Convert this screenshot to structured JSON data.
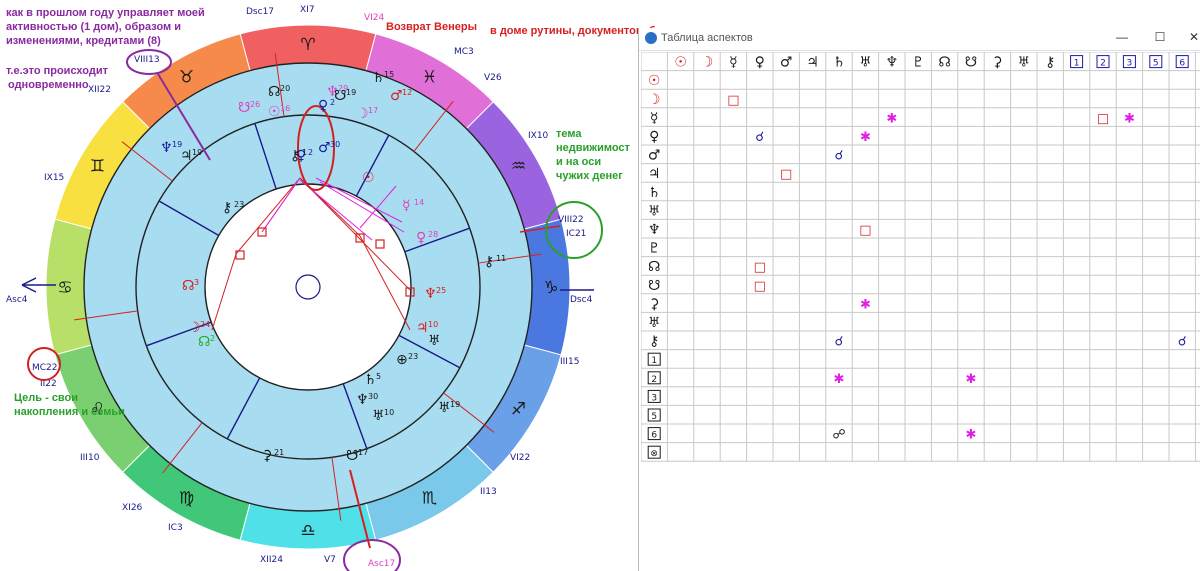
{
  "notes": {
    "top_left": [
      "как в прошлом году управляет моей",
      "активностью (1 дом), образом и",
      "изменениями, кредитами (8)"
    ],
    "happening": [
      "т.е.это происходит",
      "одновременно"
    ],
    "venus_return": "Возврат Венеры",
    "routine_house": "в доме рутины, документов, быта",
    "estate_theme": [
      "тема",
      "недвижимост",
      "и на оси",
      "чужих денег"
    ],
    "goal": [
      "Цель - свои",
      "накопления и семьи"
    ]
  },
  "colors": {
    "note_purple": "#8a2aa0",
    "note_red": "#d62020",
    "note_green": "#2aa02a",
    "wheel_inner": "#a8dcf0",
    "square": "#d62020",
    "sextile": "#e020e0",
    "trine": "#20b020",
    "conjunction": "#1a1aa0"
  },
  "zodiac_ring": [
    {
      "sign": "aries",
      "glyph": "♈",
      "color": "#f06060"
    },
    {
      "sign": "taurus",
      "glyph": "♉",
      "color": "#f58a4a"
    },
    {
      "sign": "gemini",
      "glyph": "♊",
      "color": "#f8e040"
    },
    {
      "sign": "cancer",
      "glyph": "♋",
      "color": "#b8e068"
    },
    {
      "sign": "leo",
      "glyph": "♌",
      "color": "#7ad070"
    },
    {
      "sign": "virgo",
      "glyph": "♍",
      "color": "#40c878"
    },
    {
      "sign": "libra",
      "glyph": "♎",
      "color": "#50e0e8"
    },
    {
      "sign": "scorpio",
      "glyph": "♏",
      "color": "#7ac8ea"
    },
    {
      "sign": "sagittarius",
      "glyph": "♐",
      "color": "#6aa0e8"
    },
    {
      "sign": "capricorn",
      "glyph": "♑",
      "color": "#4a78e0"
    },
    {
      "sign": "aquarius",
      "glyph": "♒",
      "color": "#9a64e0"
    },
    {
      "sign": "pisces",
      "glyph": "♓",
      "color": "#e070d8"
    }
  ],
  "house_labels": [
    {
      "text": "Dsc17",
      "color": "#1a1a8a"
    },
    {
      "text": "XI7",
      "color": "#1a1a8a"
    },
    {
      "text": "VI24",
      "color": "#e040c0"
    },
    {
      "text": "MC3",
      "color": "#1a1a8a"
    },
    {
      "text": "V26",
      "color": "#1a1a8a"
    },
    {
      "text": "IX10",
      "color": "#1a1a8a"
    },
    {
      "text": "VIII22",
      "color": "#1a1a8a"
    },
    {
      "text": "IC21",
      "color": "#1a1a8a"
    },
    {
      "text": "Dsc4",
      "color": "#1a1a8a"
    },
    {
      "text": "III15",
      "color": "#1a1a8a"
    },
    {
      "text": "VI22",
      "color": "#1a1a8a"
    },
    {
      "text": "II13",
      "color": "#1a1a8a"
    },
    {
      "text": "V7",
      "color": "#1a1a8a"
    },
    {
      "text": "Asc17",
      "color": "#e040c0"
    },
    {
      "text": "XII24",
      "color": "#1a1a8a"
    },
    {
      "text": "IC3",
      "color": "#1a1a8a"
    },
    {
      "text": "XI26",
      "color": "#1a1a8a"
    },
    {
      "text": "III10",
      "color": "#1a1a8a"
    },
    {
      "text": "II22",
      "color": "#1a1a8a"
    },
    {
      "text": "MC22",
      "color": "#1a1a8a"
    },
    {
      "text": "Asc4",
      "color": "#1a1a8a"
    },
    {
      "text": "IX15",
      "color": "#1a1a8a"
    },
    {
      "text": "XII22",
      "color": "#1a1a8a"
    },
    {
      "text": "VIII13",
      "color": "#1a1a8a"
    }
  ],
  "planets": [
    {
      "glyph": "☊",
      "deg": "20",
      "color": "#1a1a1a"
    },
    {
      "glyph": "☋",
      "deg": "26",
      "color": "#e040c0"
    },
    {
      "glyph": "☉",
      "deg": "16",
      "color": "#e040c0"
    },
    {
      "glyph": "♆",
      "deg": "29",
      "color": "#e040c0"
    },
    {
      "glyph": "♄",
      "deg": "15",
      "color": "#1a1a1a"
    },
    {
      "glyph": "♂",
      "deg": "12",
      "color": "#d62020"
    },
    {
      "glyph": "♀",
      "deg": "2",
      "color": "#1a1aa0"
    },
    {
      "glyph": "☋",
      "deg": "19",
      "color": "#1a1a1a"
    },
    {
      "glyph": "☽",
      "deg": "17",
      "color": "#e040c0"
    },
    {
      "glyph": "♆",
      "deg": "19",
      "color": "#1a1aa0"
    },
    {
      "glyph": "♃",
      "deg": "19",
      "color": "#1a1a1a"
    },
    {
      "glyph": "♂",
      "deg": "30",
      "color": "#1a1aa0"
    },
    {
      "glyph": "♀",
      "deg": "2",
      "color": "#1a1aa0"
    },
    {
      "glyph": "⚷",
      "deg": "1",
      "color": "#1a1a1a"
    },
    {
      "glyph": "☉",
      "deg": "",
      "color": "#d62020"
    },
    {
      "glyph": "⚷",
      "deg": "23",
      "color": "#1a1a1a"
    },
    {
      "glyph": "☿",
      "deg": "14",
      "color": "#e040c0"
    },
    {
      "glyph": "♀",
      "deg": "28",
      "color": "#e040c0"
    },
    {
      "glyph": "⚷",
      "deg": "11",
      "color": "#1a1a1a"
    },
    {
      "glyph": "♆",
      "deg": "25",
      "color": "#d62020"
    },
    {
      "glyph": "☊",
      "deg": "3",
      "color": "#d62020"
    },
    {
      "glyph": "☽",
      "deg": "24",
      "color": "#d62020"
    },
    {
      "glyph": "☊",
      "deg": "2",
      "color": "#20b020"
    },
    {
      "glyph": "♃",
      "deg": "10",
      "color": "#d62020"
    },
    {
      "glyph": "♅",
      "deg": "",
      "color": "#1a1a1a"
    },
    {
      "glyph": "⊕",
      "deg": "23",
      "color": "#1a1a1a"
    },
    {
      "glyph": "♄",
      "deg": "5",
      "color": "#1a1a1a"
    },
    {
      "glyph": "♆",
      "deg": "30",
      "color": "#1a1a1a"
    },
    {
      "glyph": "♅",
      "deg": "10",
      "color": "#1a1a1a"
    },
    {
      "glyph": "♅",
      "deg": "19",
      "color": "#1a1a1a"
    },
    {
      "glyph": "⚳",
      "deg": "21",
      "color": "#1a1a1a"
    },
    {
      "glyph": "☋",
      "deg": "17",
      "color": "#1a1a1a"
    }
  ],
  "aspect_window": {
    "title": "Таблица аспектов",
    "peek_title": "",
    "minimize": "—",
    "maximize": "☐",
    "close": "✕"
  },
  "aspect_table": {
    "columns": [
      {
        "glyph": "☉",
        "color": "#d62020",
        "boxed": false
      },
      {
        "glyph": "☽",
        "color": "#d62020",
        "boxed": false
      },
      {
        "glyph": "☿",
        "color": "#1a1a1a",
        "boxed": false
      },
      {
        "glyph": "♀",
        "color": "#1a1a1a",
        "boxed": false
      },
      {
        "glyph": "♂",
        "color": "#1a1a1a",
        "boxed": false
      },
      {
        "glyph": "♃",
        "color": "#1a1a1a",
        "boxed": false
      },
      {
        "glyph": "♄",
        "color": "#1a1a1a",
        "boxed": false
      },
      {
        "glyph": "♅",
        "color": "#1a1a1a",
        "boxed": false
      },
      {
        "glyph": "♆",
        "color": "#1a1a1a",
        "boxed": false
      },
      {
        "glyph": "♇",
        "color": "#1a1a1a",
        "boxed": false
      },
      {
        "glyph": "☊",
        "color": "#1a1a1a",
        "boxed": false
      },
      {
        "glyph": "☋",
        "color": "#1a1a1a",
        "boxed": false
      },
      {
        "glyph": "⚳",
        "color": "#1a1a1a",
        "boxed": false
      },
      {
        "glyph": "♅",
        "color": "#1a1a1a",
        "boxed": false
      },
      {
        "glyph": "⚷",
        "color": "#1a1a1a",
        "boxed": false
      },
      {
        "glyph": "1",
        "color": "#1a1aa0",
        "boxed": true
      },
      {
        "glyph": "2",
        "color": "#1a1aa0",
        "boxed": true
      },
      {
        "glyph": "3",
        "color": "#1a1aa0",
        "boxed": true
      },
      {
        "glyph": "5",
        "color": "#1a1aa0",
        "boxed": true
      },
      {
        "glyph": "6",
        "color": "#1a1aa0",
        "boxed": true
      },
      {
        "glyph": "⊗",
        "color": "#1a1aa0",
        "boxed": true
      }
    ],
    "rows": [
      {
        "glyph": "☉",
        "color": "#d62020",
        "boxed": false
      },
      {
        "glyph": "☽",
        "color": "#d62020",
        "boxed": false
      },
      {
        "glyph": "☿",
        "color": "#1a1a1a",
        "boxed": false
      },
      {
        "glyph": "♀",
        "color": "#1a1a1a",
        "boxed": false
      },
      {
        "glyph": "♂",
        "color": "#1a1a1a",
        "boxed": false
      },
      {
        "glyph": "♃",
        "color": "#1a1a1a",
        "boxed": false
      },
      {
        "glyph": "♄",
        "color": "#1a1a1a",
        "boxed": false
      },
      {
        "glyph": "♅",
        "color": "#1a1a1a",
        "boxed": false
      },
      {
        "glyph": "♆",
        "color": "#1a1a1a",
        "boxed": false
      },
      {
        "glyph": "♇",
        "color": "#1a1a1a",
        "boxed": false
      },
      {
        "glyph": "☊",
        "color": "#1a1a1a",
        "boxed": false
      },
      {
        "glyph": "☋",
        "color": "#1a1a1a",
        "boxed": false
      },
      {
        "glyph": "⚳",
        "color": "#1a1a1a",
        "boxed": false
      },
      {
        "glyph": "♅",
        "color": "#1a1a1a",
        "boxed": false
      },
      {
        "glyph": "⚷",
        "color": "#1a1a1a",
        "boxed": false
      },
      {
        "glyph": "1",
        "color": "#1a1a1a",
        "boxed": true
      },
      {
        "glyph": "2",
        "color": "#1a1a1a",
        "boxed": true
      },
      {
        "glyph": "3",
        "color": "#1a1a1a",
        "boxed": true
      },
      {
        "glyph": "5",
        "color": "#1a1a1a",
        "boxed": true
      },
      {
        "glyph": "6",
        "color": "#1a1a1a",
        "boxed": true
      },
      {
        "glyph": "⊗",
        "color": "#1a1a1a",
        "boxed": true
      }
    ],
    "cells": [
      {
        "row": 1,
        "col": 2,
        "glyph": "□",
        "color": "#d62020"
      },
      {
        "row": 1,
        "col": 20,
        "glyph": "△",
        "color": "#20b020"
      },
      {
        "row": 2,
        "col": 8,
        "glyph": "✱",
        "color": "#e020e0"
      },
      {
        "row": 2,
        "col": 16,
        "glyph": "□",
        "color": "#d62020"
      },
      {
        "row": 2,
        "col": 17,
        "glyph": "✱",
        "color": "#e020e0"
      },
      {
        "row": 3,
        "col": 3,
        "glyph": "☌",
        "color": "#1a1aa0"
      },
      {
        "row": 3,
        "col": 7,
        "glyph": "✱",
        "color": "#e020e0"
      },
      {
        "row": 4,
        "col": 6,
        "glyph": "☌",
        "color": "#1a1aa0"
      },
      {
        "row": 5,
        "col": 4,
        "glyph": "□",
        "color": "#d62020"
      },
      {
        "row": 8,
        "col": 7,
        "glyph": "□",
        "color": "#d62020"
      },
      {
        "row": 10,
        "col": 3,
        "glyph": "□",
        "color": "#d62020"
      },
      {
        "row": 11,
        "col": 3,
        "glyph": "□",
        "color": "#d62020"
      },
      {
        "row": 12,
        "col": 7,
        "glyph": "✱",
        "color": "#e020e0"
      },
      {
        "row": 14,
        "col": 6,
        "glyph": "☌",
        "color": "#1a1aa0"
      },
      {
        "row": 14,
        "col": 19,
        "glyph": "☌",
        "color": "#1a1aa0"
      },
      {
        "row": 16,
        "col": 6,
        "glyph": "✱",
        "color": "#e020e0"
      },
      {
        "row": 16,
        "col": 11,
        "glyph": "✱",
        "color": "#e020e0"
      },
      {
        "row": 16,
        "col": 20,
        "glyph": "☌",
        "color": "#1a1aa0"
      },
      {
        "row": 19,
        "col": 6,
        "glyph": "☍",
        "color": "#1a1a1a"
      },
      {
        "row": 19,
        "col": 11,
        "glyph": "✱",
        "color": "#e020e0"
      }
    ]
  }
}
